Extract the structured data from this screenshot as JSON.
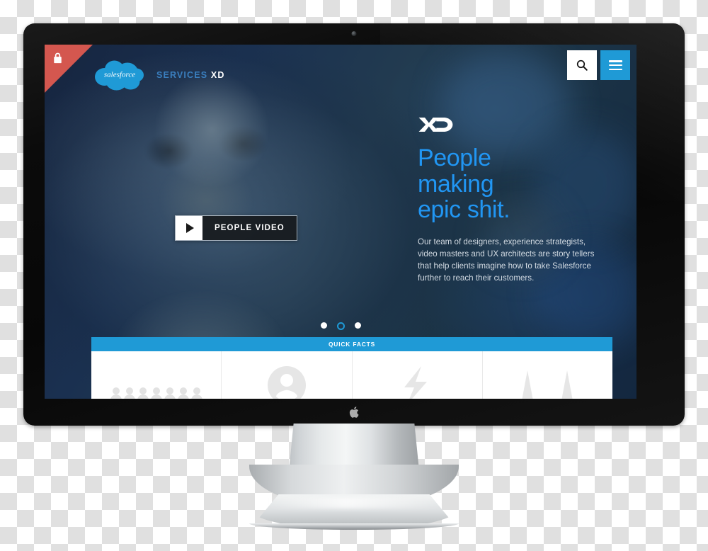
{
  "page": {
    "device": "apple-thunderbolt-display",
    "brand_logo_alt": "Apple"
  },
  "site": {
    "ribbon": {
      "icon": "lock-icon",
      "color": "#d4574f"
    },
    "logo": {
      "name": "salesforce",
      "wordmark": "salesforce",
      "color": "#1f9ad6"
    },
    "section_label": {
      "primary": "SERVICES",
      "secondary": "XD"
    },
    "nav": {
      "search": {
        "label": "Search",
        "icon": "search-icon"
      },
      "menu": {
        "label": "Menu",
        "icon": "hamburger-icon",
        "color": "#1f9ad6"
      }
    }
  },
  "hero": {
    "xd_mark": "XD",
    "headline_lines": [
      "People",
      "making",
      "epic shit."
    ],
    "headline_color": "#2196f3",
    "paragraph": "Our team of designers, experience strategists, video masters and UX architects are story tellers that help clients imagine how to take Salesforce further to reach their customers.",
    "video_button": {
      "label": "PEOPLE VIDEO",
      "icon": "play-icon"
    },
    "carousel": {
      "total": 3,
      "active_index": 1,
      "dots": [
        "slide-1",
        "slide-2",
        "slide-3"
      ]
    }
  },
  "quick_facts": {
    "title": "QUICK FACTS",
    "accent": "#1f9ad6",
    "columns": [
      {
        "icon": "people-group-icon"
      },
      {
        "icon": "person-badge-icon"
      },
      {
        "icon": "lightning-bolt-icon"
      },
      {
        "icon": "peaks-icon"
      }
    ]
  }
}
